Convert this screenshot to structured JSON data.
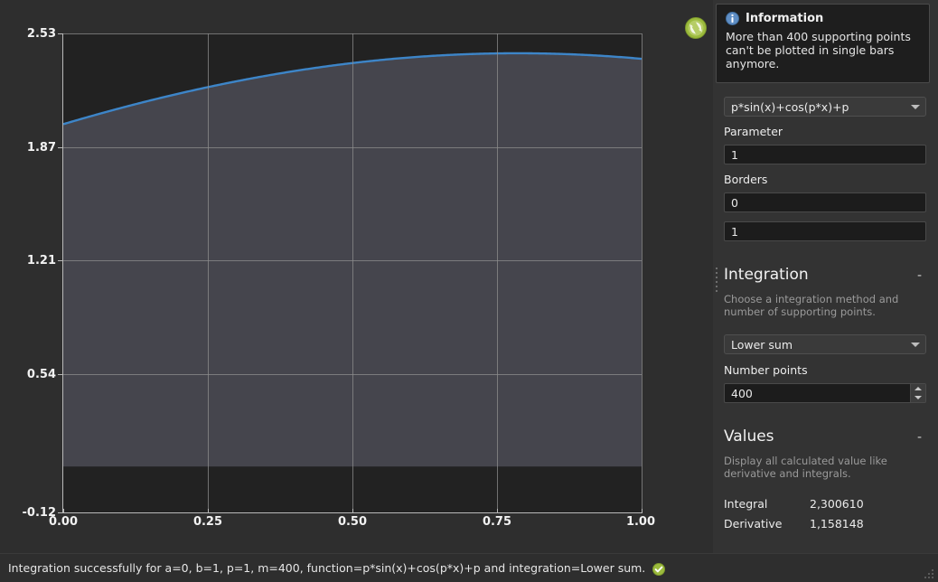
{
  "window": {
    "background": "#2e2e2e",
    "panel_background": "#333333"
  },
  "chart_data": {
    "type": "line",
    "title": "",
    "xlabel": "",
    "ylabel": "",
    "function_expression": "p*sin(x)+cos(p*x)+p",
    "parameter_p": 1,
    "xlim": [
      0.0,
      1.0
    ],
    "ylim": [
      -0.12,
      2.53
    ],
    "x_ticks": [
      "0.00",
      "0.25",
      "0.50",
      "0.75",
      "1.00"
    ],
    "x_tick_values": [
      0.0,
      0.25,
      0.5,
      0.75,
      1.0
    ],
    "y_ticks": [
      "2.53",
      "1.87",
      "1.21",
      "0.54",
      "-0.12"
    ],
    "y_tick_values": [
      2.53,
      1.87,
      1.21,
      0.54,
      -0.12
    ],
    "grid": true,
    "legend": "none",
    "series": [
      {
        "name": "p*sin(x)+cos(p*x)+p",
        "color": "#3d85c8",
        "fill_color": "#45454d",
        "fill_to": 0,
        "x": [
          0.0,
          0.05,
          0.1,
          0.15,
          0.2,
          0.25,
          0.3,
          0.35,
          0.4,
          0.45,
          0.5,
          0.55,
          0.6,
          0.65,
          0.7,
          0.75,
          0.8,
          0.85,
          0.9,
          0.95,
          1.0
        ],
        "y": [
          2.0,
          2.049,
          2.095,
          2.138,
          2.178,
          2.216,
          2.25,
          2.28,
          2.308,
          2.333,
          2.355,
          2.373,
          2.388,
          2.4,
          2.409,
          2.414,
          2.416,
          2.415,
          2.41,
          2.402,
          2.382
        ]
      }
    ]
  },
  "reload_button": {
    "icon": "refresh-icon",
    "color": "#9cbb3d"
  },
  "information": {
    "icon": "info-icon",
    "title": "Information",
    "message": "More than 400 supporting points can't be plotted in single bars anymore."
  },
  "function_select": {
    "value": "p*sin(x)+cos(p*x)+p",
    "icon": "chevron-down-icon"
  },
  "parameter": {
    "label": "Parameter",
    "value": "1"
  },
  "borders": {
    "label": "Borders",
    "lower_value": "0",
    "upper_value": "1"
  },
  "integration_section": {
    "title": "Integration",
    "collapse_glyph": "-",
    "description": "Choose a integration method and number of supporting points.",
    "method": {
      "value": "Lower sum",
      "icon": "chevron-down-icon"
    },
    "points": {
      "label": "Number points",
      "value": "400"
    }
  },
  "values_section": {
    "title": "Values",
    "collapse_glyph": "-",
    "description": "Display all calculated value like derivative and integrals.",
    "rows": [
      {
        "name": "Integral",
        "value": "2,300610"
      },
      {
        "name": "Derivative",
        "value": "1,158148"
      }
    ]
  },
  "statusbar": {
    "message": "Integration successfully for a=0, b=1, p=1, m=400, function=p*sin(x)+cos(p*x)+p and integration=Lower sum.",
    "icon": "success-check-icon",
    "resize_grip": "resize-grip-icon"
  }
}
